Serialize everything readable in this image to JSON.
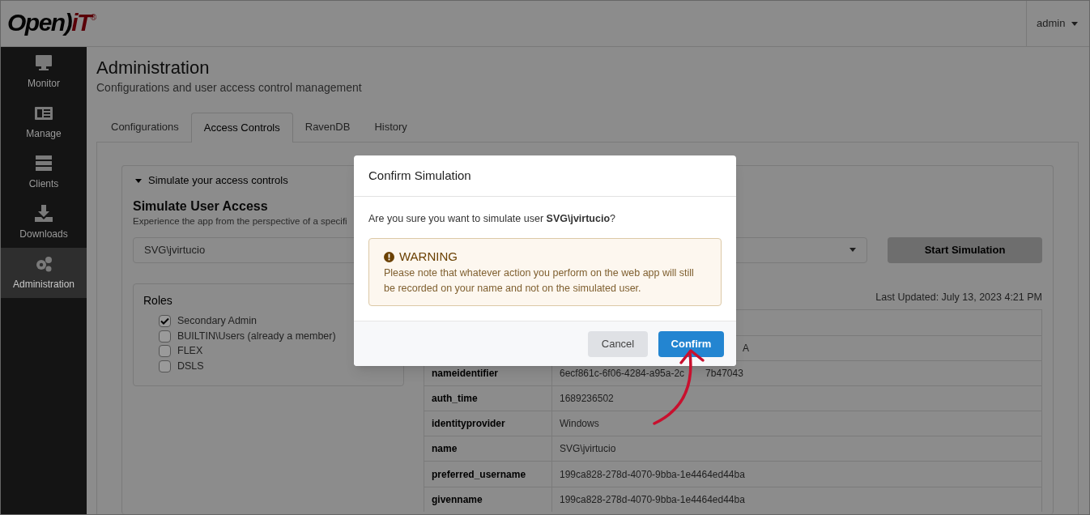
{
  "header": {
    "logo": {
      "part_1": "Open)",
      "part_2": "iT",
      "mark": "®"
    },
    "user_menu": "admin"
  },
  "sidebar": {
    "items": [
      {
        "label": "Monitor",
        "selected": false
      },
      {
        "label": "Manage",
        "selected": false
      },
      {
        "label": "Clients",
        "selected": false
      },
      {
        "label": "Downloads",
        "selected": false
      },
      {
        "label": "Administration",
        "selected": true
      }
    ]
  },
  "page": {
    "title": "Administration",
    "subtitle": "Configurations and user access control management"
  },
  "tabs": [
    {
      "label": "Configurations",
      "selected": false
    },
    {
      "label": "Access Controls",
      "selected": true
    },
    {
      "label": "RavenDB",
      "selected": false
    },
    {
      "label": "History",
      "selected": false
    }
  ],
  "simulate": {
    "section_title": "Simulate your access controls",
    "expanded": true,
    "heading": "Simulate User Access",
    "description": "Experience the app from the perspective of a specifi",
    "user_select": "SVG\\jvirtucio",
    "start_button": "Start Simulation",
    "roles_title": "Roles",
    "roles": [
      {
        "label": "Secondary Admin",
        "checked": true
      },
      {
        "label": "BUILTIN\\Users (already a member)",
        "checked": false
      },
      {
        "label": "FLEX",
        "checked": false
      },
      {
        "label": "DSLS",
        "checked": false
      }
    ],
    "last_updated": "Last Updated: July 13, 2023 4:21 PM",
    "claims": [
      {
        "column_2": "A"
      },
      {
        "column_1": "nameidentifier",
        "column_2": "6ecf861c-6f06-4284-a95a-2c",
        "column_2_after_arrow": "7b47043"
      },
      {
        "column_1": "auth_time",
        "column_2": "1689236502"
      },
      {
        "column_1": "identityprovider",
        "column_2": "Windows"
      },
      {
        "column_1": "name",
        "column_2": "SVG\\jvirtucio"
      },
      {
        "column_1": "preferred_username",
        "column_2": "199ca828-278d-4070-9bba-1e4464ed44ba"
      },
      {
        "column_1": "givenname",
        "column_2": "199ca828-278d-4070-9bba-1e4464ed44ba"
      }
    ]
  },
  "dialog": {
    "title": "Confirm Simulation",
    "message": "Are you sure you want to simulate user **SVG\\jvirtucio**?",
    "warning_title": "WARNING",
    "warning_text": "Please note that whatever action you perform on the web app will still be recorded on your name and not on the simulated user.",
    "buttons": [
      {
        "label": "Cancel",
        "kind": "secondary"
      },
      {
        "label": "Confirm",
        "kind": "primary"
      }
    ]
  }
}
